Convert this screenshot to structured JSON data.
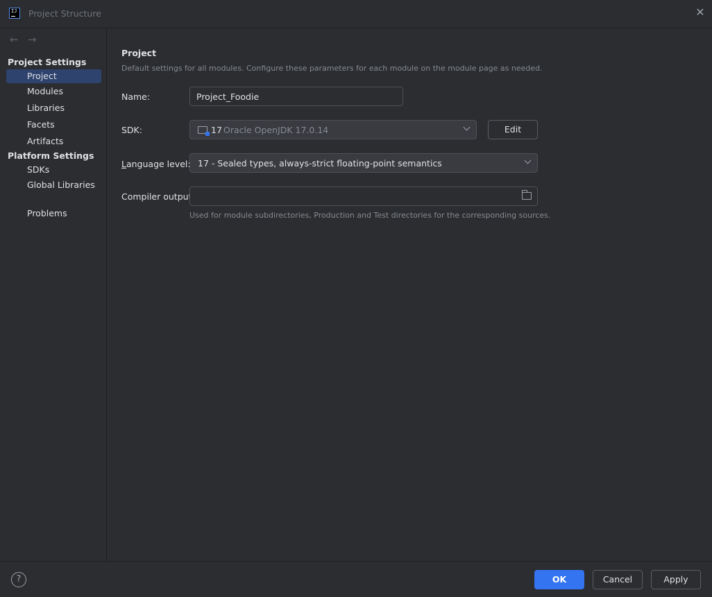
{
  "window": {
    "title": "Project Structure",
    "app_icon_text": "IJ"
  },
  "sidebar": {
    "project_settings_header": "Project Settings",
    "platform_settings_header": "Platform Settings",
    "items": [
      {
        "label": "Project",
        "selected": true
      },
      {
        "label": "Modules"
      },
      {
        "label": "Libraries"
      },
      {
        "label": "Facets"
      },
      {
        "label": "Artifacts"
      },
      {
        "label": "SDKs"
      },
      {
        "label": "Global Libraries"
      },
      {
        "label": "Problems"
      }
    ]
  },
  "main": {
    "heading": "Project",
    "subtitle": "Default settings for all modules. Configure these parameters for each module on the module page as needed.",
    "name_label": "Name:",
    "name_value": "Project_Foodie",
    "sdk_label": "SDK:",
    "sdk_version": "17",
    "sdk_name": "Oracle OpenJDK 17.0.14",
    "edit_label": "Edit",
    "language_level_label_prefix": "L",
    "language_level_label_rest": "anguage level:",
    "language_level_value": "17 - Sealed types, always-strict floating-point semantics",
    "compiler_output_label": "Compiler output:",
    "compiler_output_value": "",
    "compiler_output_hint": "Used for module subdirectories, Production and Test directories for the corresponding sources."
  },
  "footer": {
    "help_label": "?",
    "ok_label": "OK",
    "cancel_label": "Cancel",
    "apply_label": "Apply"
  },
  "colors": {
    "accent": "#3574f0",
    "selection": "#2e436e",
    "background": "#2b2d30"
  }
}
